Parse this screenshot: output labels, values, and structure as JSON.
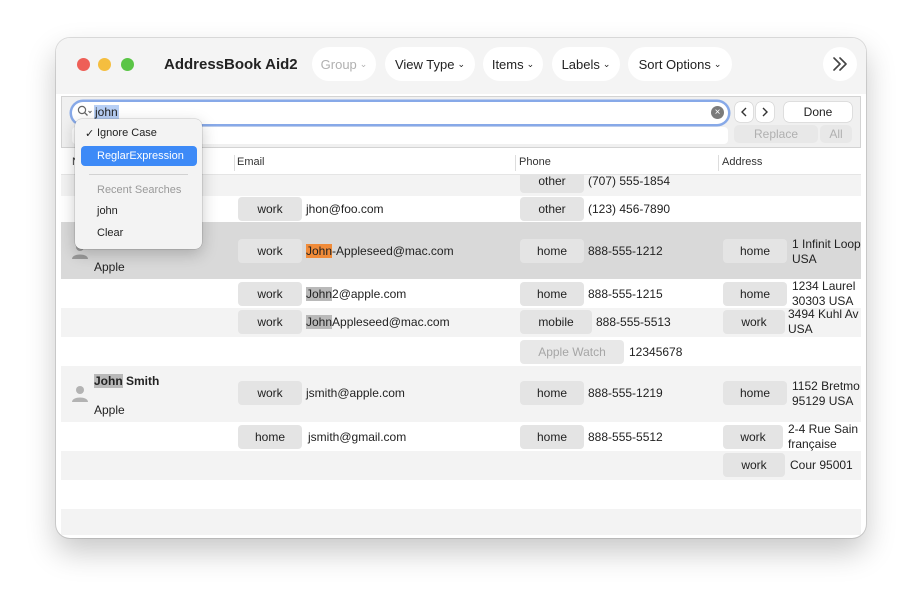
{
  "app": {
    "title": "AddressBook Aid2"
  },
  "toolbar": {
    "group": "Group",
    "view_type": "View Type",
    "items": "Items",
    "labels": "Labels",
    "sort_options": "Sort Options"
  },
  "find": {
    "query": "john",
    "done": "Done",
    "replace": "Replace",
    "all": "All"
  },
  "menu": {
    "ignore_case": "Ignore Case",
    "regex": "ReglarExpression",
    "recent_header": "Recent Searches",
    "recent_item": "john",
    "clear": "Clear"
  },
  "columns": {
    "name": "N",
    "email": "Email",
    "phone": "Phone",
    "address": "Address"
  },
  "contacts": {
    "r0": {
      "phone_label": "other",
      "phone": "(707) 555-1854"
    },
    "r1": {
      "email_label": "work",
      "email": "jhon@foo.com",
      "phone_label": "other",
      "phone": "(123) 456-7890"
    },
    "r2": {
      "company": "Apple",
      "email_label": "work",
      "email_match": "John",
      "email_rest": "-Appleseed@mac.com",
      "phone_label": "home",
      "phone": "888-555-1212",
      "addr_label": "home",
      "addr_line1": "1 Infinit Loop",
      "addr_line2": "USA"
    },
    "r3": {
      "email_label": "work",
      "email_match": "John",
      "email_rest": "2@apple.com",
      "phone_label": "home",
      "phone": "888-555-1215",
      "addr_label": "home",
      "addr_line1": "1234 Laurel",
      "addr_line2": "30303 USA"
    },
    "r4": {
      "email_label": "work",
      "email_match": "John",
      "email_rest": "Appleseed@mac.com",
      "phone_label": "mobile",
      "phone": "888-555-5513",
      "addr_label": "work",
      "addr_line1": "3494 Kuhl Av",
      "addr_line2": "USA"
    },
    "r5": {
      "phone_label": "Apple Watch",
      "phone": "12345678"
    },
    "r6": {
      "name_match": "John",
      "name_rest": " Smith",
      "company": "Apple",
      "email_label": "work",
      "email": "jsmith@apple.com",
      "phone_label": "home",
      "phone": "888-555-1219",
      "addr_label": "home",
      "addr_line1": "1152 Bretmo",
      "addr_line2": "95129 USA"
    },
    "r7": {
      "email_label": "home",
      "email": "jsmith@gmail.com",
      "phone_label": "home",
      "phone": "888-555-5512",
      "addr_label": "work",
      "addr_line1": "2-4 Rue Sain",
      "addr_line2": "française"
    },
    "r8": {
      "addr_label": "work",
      "addr_line1": "Cour 95001"
    }
  },
  "colors": {
    "accent": "#3d8af7",
    "match_active": "#f08b39",
    "match": "#b9b9b9",
    "selected_row": "#d9d9d9"
  },
  "icons": [
    "search-icon",
    "chevron-down-icon",
    "clear-icon",
    "chevron-left-icon",
    "chevron-right-icon",
    "double-chevron-right-icon",
    "person-icon",
    "checkmark-icon"
  ]
}
